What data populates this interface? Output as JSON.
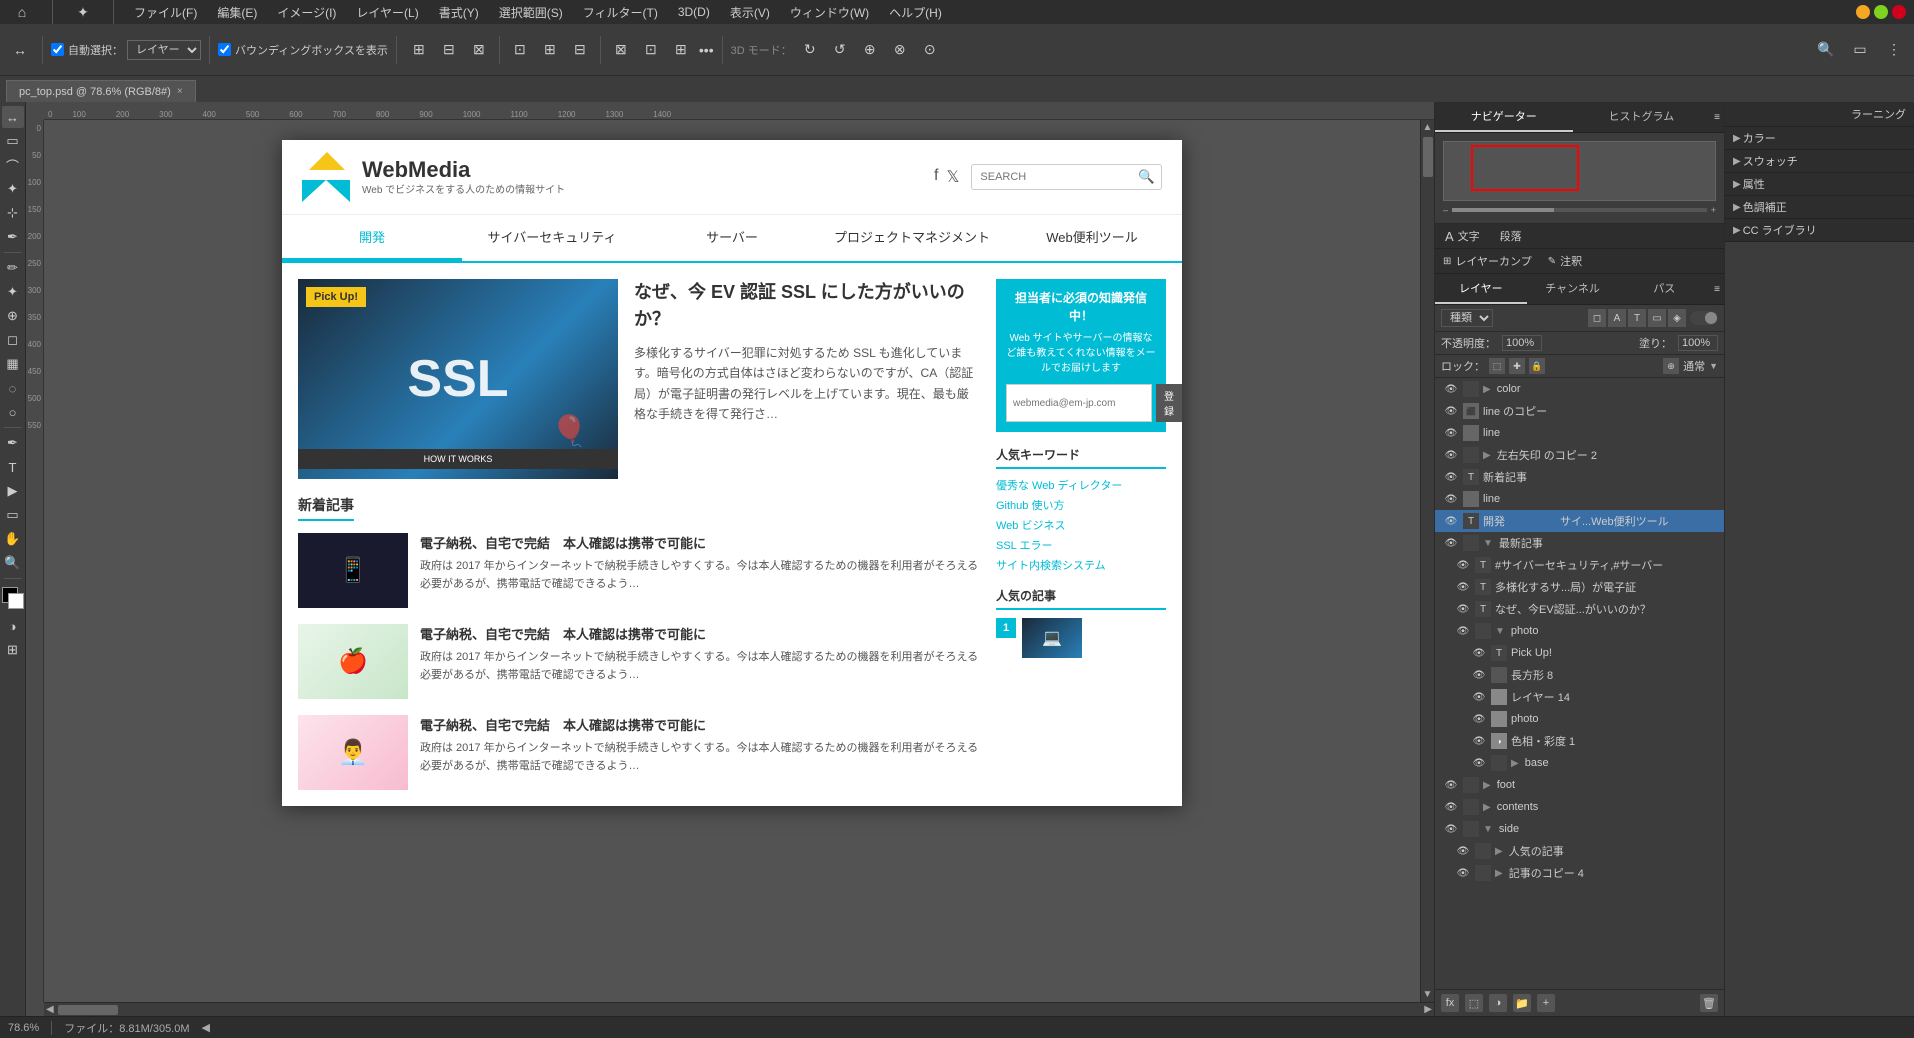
{
  "app": {
    "title": "Adobe Photoshop",
    "menu_items": [
      "ファイル(F)",
      "編集(E)",
      "イメージ(I)",
      "レイヤー(L)",
      "書式(Y)",
      "選択範囲(S)",
      "フィルター(T)",
      "3D(D)",
      "表示(V)",
      "ウィンドウ(W)",
      "ヘルプ(H)"
    ]
  },
  "tab": {
    "name": "pc_top.psd @ 78.6% (RGB/8#)",
    "close": "×"
  },
  "toolbar": {
    "auto_select_label": "自動選択：",
    "layer_label": "レイヤー ▼",
    "bounding_box_label": "バウンディングボックスを表示",
    "mode_3d": "3D モード：",
    "more": "•••"
  },
  "status_bar": {
    "zoom": "78.6%",
    "file_info": "ファイル：8.81M/305.0M",
    "separator": "◀"
  },
  "website": {
    "logo_main": "WebMedia",
    "logo_sub": "Web でビジネスをする人のための情報サイト",
    "search_placeholder": "SEARCH",
    "nav_items": [
      "開発",
      "サイバーセキュリティ",
      "サーバー",
      "プロジェクトマネジメント",
      "Web便利ツール"
    ],
    "nav_active": "開発",
    "hero": {
      "badge": "Pick Up!",
      "title": "なぜ、今 EV 認証 SSL にした方がいいのか？",
      "description": "多様化するサイバー犯罪に対処するため SSL も進化しています。暗号化の方式自体はさほど変わらないのですが、CA（認証局）が電子証明書の発行レベルを上げています。現在、最も厳格な手続きを得て発行さ…",
      "ssl_text": "SSL"
    },
    "recent_articles": {
      "title": "新着記事",
      "items": [
        {
          "title": "電子納税、自宅で完結　本人確認は携帯で可能に",
          "excerpt": "政府は 2017 年からインターネットで納税手続きしやすくする。今は本人確認するための機器を利用者がそろえる必要があるが、携帯電話で確認できるよう…"
        },
        {
          "title": "電子納税、自宅で完結　本人確認は携帯で可能に",
          "excerpt": "政府は 2017 年からインターネットで納税手続きしやすくする。今は本人確認するための機器を利用者がそろえる必要があるが、携帯電話で確認できるよう…"
        },
        {
          "title": "電子納税、自宅で完結　本人確認は携帯で可能に",
          "excerpt": "政府は 2017 年からインターネットで納税手続きしやすくする。今は本人確認するための機器を利用者がそろえる必要があるが、携帯電話で確認できるよう…"
        }
      ]
    },
    "sidebar": {
      "newsletter": {
        "title": "担当者に必須の知識発信中！",
        "description": "Web サイトやサーバーの情報など誰も教えてくれない情報をメールでお届けします",
        "placeholder": "webmedia@em-jp.com",
        "btn_label": "登録"
      },
      "popular_keywords": {
        "title": "人気キーワード",
        "tags": [
          "優秀な Web ディレクター",
          "Github 使い方",
          "Web ビジネス",
          "SSL エラー",
          "サイト内検索システム"
        ]
      },
      "popular_articles": {
        "title": "人気の記事"
      }
    }
  },
  "right_panel": {
    "tabs": [
      "ナビゲーター",
      "ヒストグラム"
    ],
    "active_tab": "ナビゲーター",
    "layers_section": {
      "tabs": [
        "レイヤー",
        "チャンネル",
        "パス"
      ],
      "active_tab": "レイヤー",
      "search_placeholder": "種類",
      "opacity_label": "不透明度：",
      "opacity_value": "100%",
      "fill_label": "塗り：",
      "fill_value": "100%",
      "lock_label": "ロック：",
      "items": [
        {
          "name": "color",
          "type": "group",
          "visible": true,
          "indent": 0
        },
        {
          "name": "line のコピー",
          "type": "layer",
          "visible": true,
          "indent": 0
        },
        {
          "name": "line",
          "type": "layer",
          "visible": true,
          "indent": 0
        },
        {
          "name": "左右矢印 のコピー 2",
          "type": "group",
          "visible": true,
          "indent": 0
        },
        {
          "name": "新着記事",
          "type": "text",
          "visible": true,
          "indent": 0
        },
        {
          "name": "line",
          "type": "layer",
          "visible": true,
          "indent": 0
        },
        {
          "name": "開発　　　　　サイ...Web便利ツール",
          "type": "text",
          "visible": true,
          "indent": 0,
          "selected": true
        },
        {
          "name": "最新記事",
          "type": "group",
          "visible": true,
          "indent": 0,
          "expanded": true
        },
        {
          "name": "#サイバーセキュリティ,#サーバー",
          "type": "text",
          "visible": true,
          "indent": 1
        },
        {
          "name": "多様化するサ...局）が電子証",
          "type": "text",
          "visible": true,
          "indent": 1
        },
        {
          "name": "なぜ、今EV認証...がいいのか？",
          "type": "text",
          "visible": true,
          "indent": 1
        },
        {
          "name": "photo",
          "type": "group",
          "visible": true,
          "indent": 1,
          "expanded": true
        },
        {
          "name": "Pick Up!",
          "type": "text",
          "visible": true,
          "indent": 2
        },
        {
          "name": "長方形 8",
          "type": "shape",
          "visible": true,
          "indent": 2
        },
        {
          "name": "レイヤー 14",
          "type": "layer",
          "visible": true,
          "indent": 2
        },
        {
          "name": "photo",
          "type": "layer",
          "visible": true,
          "indent": 2
        },
        {
          "name": "色相・彩度 1",
          "type": "adjustment",
          "visible": true,
          "indent": 2
        },
        {
          "name": "base",
          "type": "group",
          "visible": true,
          "indent": 2
        },
        {
          "name": "foot",
          "type": "group",
          "visible": true,
          "indent": 0
        },
        {
          "name": "contents",
          "type": "group",
          "visible": true,
          "indent": 0
        },
        {
          "name": "side",
          "type": "group",
          "visible": true,
          "indent": 0,
          "expanded": true
        },
        {
          "name": "人気の記事",
          "type": "group",
          "visible": true,
          "indent": 1
        },
        {
          "name": "記事のコピー 4",
          "type": "group",
          "visible": true,
          "indent": 1
        }
      ]
    }
  },
  "far_right": {
    "tab_label": "ラーニング",
    "section_items": [
      "カラー",
      "スウォッチ",
      "属性",
      "色調補正",
      "CC ライブラリ"
    ],
    "text_label": "文字",
    "paragraph_label": "段落",
    "layer_comp_label": "レイヤーカンプ",
    "notes_label": "注釈"
  }
}
